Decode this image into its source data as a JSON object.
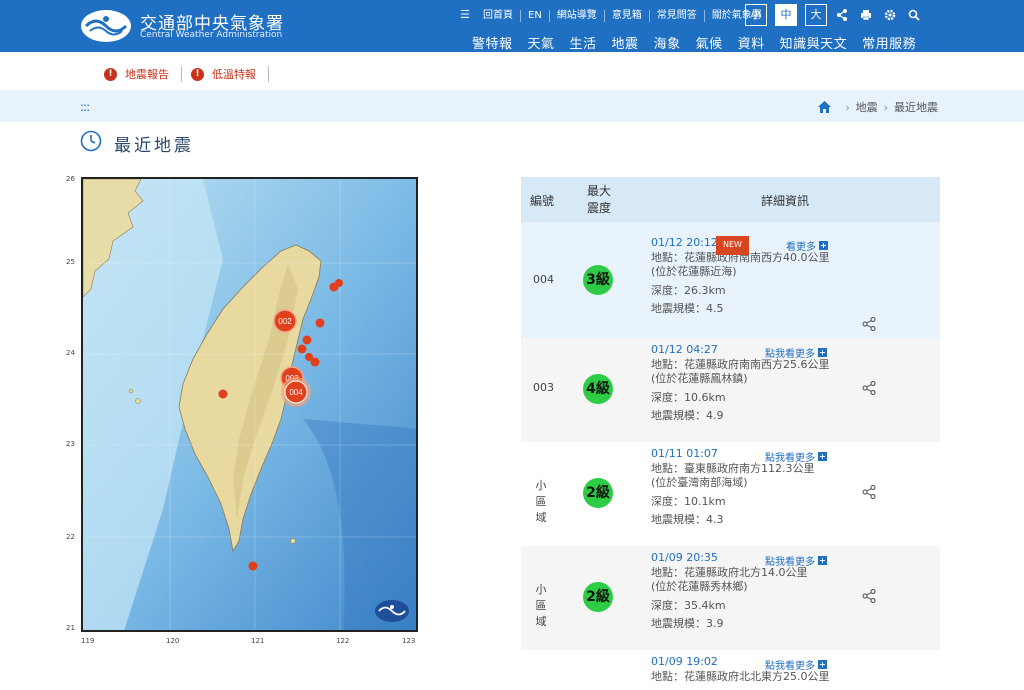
{
  "header": {
    "title": "交通部中央氣象署",
    "subtitle": "Central Weather Administration",
    "top_links": [
      "回首頁",
      "EN",
      "網站導覽",
      "意見箱",
      "常見問答",
      "關於氣象署"
    ],
    "font_sizes": [
      "小",
      "中",
      "大"
    ],
    "active_font_size": "中",
    "nav": [
      "警特報",
      "天氣",
      "生活",
      "地震",
      "海象",
      "氣候",
      "資料",
      "知識與天文",
      "常用服務"
    ],
    "brand_color": "#1f6fc2"
  },
  "alerts": [
    "地震報告",
    "低溫特報"
  ],
  "breadcrumb": [
    "地震",
    "最近地震"
  ],
  "page_title": "最近地震",
  "map": {
    "lat_labels": [
      "26",
      "25",
      "24",
      "23",
      "22",
      "21"
    ],
    "lon_labels": [
      "119",
      "120",
      "121",
      "122",
      "123"
    ],
    "markers": [
      "002",
      "003",
      "004"
    ]
  },
  "table": {
    "headers": [
      "編號",
      "最大震度",
      "詳細資訊"
    ],
    "rows": [
      {
        "id": "004",
        "level": "3級",
        "time": "01/12 20:12",
        "badge": "NEW",
        "more": "看更多",
        "location": "地點：花蓮縣政府南南西方40.0公里",
        "location2": "(位於花蓮縣近海)",
        "depth": "深度：26.3km",
        "magnitude": "地震規模：4.5"
      },
      {
        "id": "003",
        "level": "4級",
        "time": "01/12 04:27",
        "more": "點我看更多",
        "location": "地點：花蓮縣政府南南西方25.6公里",
        "location2": "(位於花蓮縣鳳林鎮)",
        "depth": "深度：10.6km",
        "magnitude": "地震規模：4.9"
      },
      {
        "id": "小區域",
        "id_lines": [
          "小區",
          "域"
        ],
        "level": "2級",
        "time": "01/11 01:07",
        "more": "點我看更多",
        "location": "地點：臺東縣政府南方112.3公里",
        "location2": "(位於臺灣南部海域)",
        "depth": "深度：10.1km",
        "magnitude": "地震規模：4.3"
      },
      {
        "id": "小區域",
        "id_lines": [
          "小區",
          "域"
        ],
        "level": "2級",
        "time": "01/09 20:35",
        "more": "點我看更多",
        "location": "地點：花蓮縣政府北方14.0公里",
        "location2": "(位於花蓮縣秀林鄉)",
        "depth": "深度：35.4km",
        "magnitude": "地震規模：3.9"
      },
      {
        "time": "01/09 19:02",
        "more": "點我看更多",
        "location": "地點：花蓮縣政府北北東方25.0公里"
      }
    ]
  }
}
